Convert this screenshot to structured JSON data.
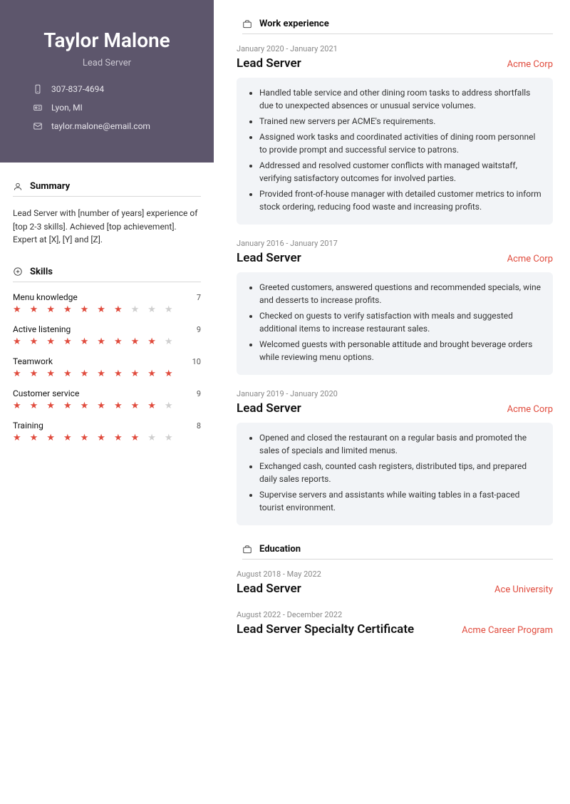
{
  "header": {
    "name": "Taylor Malone",
    "title": "Lead Server",
    "phone": "307-837-4694",
    "location": "Lyon, MI",
    "email": "taylor.malone@email.com"
  },
  "sections": {
    "summary_label": "Summary",
    "skills_label": "Skills",
    "work_label": "Work experience",
    "education_label": "Education"
  },
  "summary": "Lead Server with [number of years] experience of [top 2-3 skills]. Achieved [top achievement]. Expert at [X], [Y] and [Z].",
  "skills": [
    {
      "name": "Menu knowledge",
      "score": "7",
      "filled": 7
    },
    {
      "name": "Active listening",
      "score": "9",
      "filled": 9
    },
    {
      "name": "Teamwork",
      "score": "10",
      "filled": 10
    },
    {
      "name": "Customer service",
      "score": "9",
      "filled": 9
    },
    {
      "name": "Training",
      "score": "8",
      "filled": 8
    }
  ],
  "experience": [
    {
      "dates": "January 2020 - January 2021",
      "title": "Lead Server",
      "org": "Acme Corp",
      "bullets": [
        "Handled table service and other dining room tasks to address shortfalls due to unexpected absences or unusual service volumes.",
        "Trained new servers per ACME's requirements.",
        "Assigned work tasks and coordinated activities of dining room personnel to provide prompt and successful service to patrons.",
        "Addressed and resolved customer conflicts with managed waitstaff, verifying satisfactory outcomes for involved parties.",
        "Provided front-of-house manager with detailed customer metrics to inform stock ordering, reducing food waste and increasing profits."
      ]
    },
    {
      "dates": "January 2016 - January 2017",
      "title": "Lead Server",
      "org": "Acme Corp",
      "bullets": [
        "Greeted customers, answered questions and recommended specials, wine and desserts to increase profits.",
        "Checked on guests to verify satisfaction with meals and suggested additional items to increase restaurant sales.",
        "Welcomed guests with personable attitude and brought beverage orders while reviewing menu options."
      ]
    },
    {
      "dates": "January 2019 - January 2020",
      "title": "Lead Server",
      "org": "Acme Corp",
      "bullets": [
        "Opened and closed the restaurant on a regular basis and promoted the sales of specials and limited menus.",
        "Exchanged cash, counted cash registers, distributed tips, and prepared daily sales reports.",
        "Supervise servers and assistants while waiting tables in a fast-paced tourist environment."
      ]
    }
  ],
  "education": [
    {
      "dates": "August 2018 - May 2022",
      "title": "Lead Server",
      "org": "Ace University"
    },
    {
      "dates": "August 2022 - December 2022",
      "title": "Lead Server Specialty Certificate",
      "org": "Acme Career Program"
    }
  ]
}
